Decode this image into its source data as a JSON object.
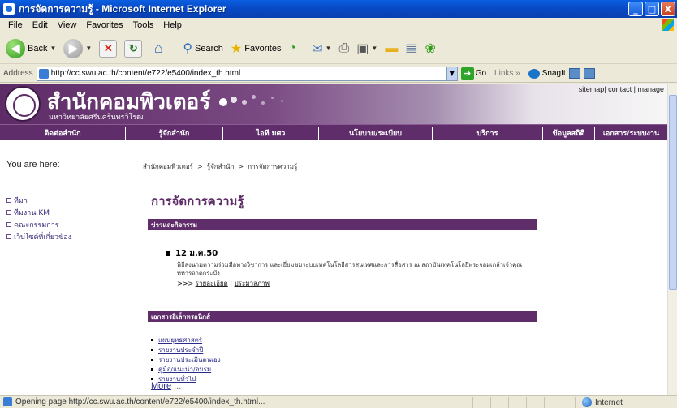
{
  "window": {
    "title": "การจัดการความรู้ - Microsoft Internet Explorer",
    "controls": [
      "_",
      "□",
      "X"
    ]
  },
  "menu": [
    "File",
    "Edit",
    "View",
    "Favorites",
    "Tools",
    "Help"
  ],
  "toolbar": {
    "back_label": "Back",
    "search_label": "Search",
    "favorites_label": "Favorites"
  },
  "addressbar": {
    "label": "Address",
    "url": "http://cc.swu.ac.th/content/e722/e5400/index_th.html",
    "go_label": "Go",
    "links_label": "Links",
    "snagit_label": "SnagIt"
  },
  "site": {
    "org_name": "สำนักคอมพิวเตอร์",
    "org_sub": "มหาวิทยาลัยศรีนครินทรวิโรฒ",
    "util_links": "sitemap| contact | manage"
  },
  "nav": [
    "ติดต่อสำนัก",
    "รู้จักสำนัก",
    "ไอที มศว",
    "นโยบาย/ระเบียบ",
    "บริการ",
    "ข้อมูลสถิติ",
    "เอกสาร/ระบบงาน"
  ],
  "breadcrumb": {
    "you_are_here": "You are here:",
    "items": [
      "สำนักคอมพิวเตอร์",
      "รู้จักสำนัก",
      "การจัดการความรู้"
    ],
    "separator": ">"
  },
  "sidebar": [
    "ทีมา",
    "ทีมงาน KM",
    "คณะกรรมการ",
    "เว็บไซต์ที่เกี่ยวข้อง"
  ],
  "main": {
    "title": "การจัดการความรู้",
    "news_header": "ข่าวและกิจกรรม",
    "news": {
      "date": "12 ม.ค.50",
      "desc": "พิธีลงนามความร่วมมือทางวิชาการ และเยี่ยมชมระบบเทคโนโลยีสารสนเทศและการสื่อสาร ณ สถาบันเทคโนโลยีพระจอมเกล้าเจ้าคุณทหารลาดกระบัง",
      "prefix": ">>>",
      "detail_link": "รายละเอียด",
      "sep": "|",
      "photo_link": "ประมวลภาพ"
    },
    "docs_header": "เอกสารอิเล็กทรอนิกส์",
    "docs": [
      "แผนยุทธศาสตร์",
      "รายงานประจำปี",
      "รายงานประเมินตนเอง",
      "คู่มือ/แนะนำ/อบรม",
      "รายงานทั่วไป"
    ],
    "more": "More",
    "more_ellipsis": "..."
  },
  "status": {
    "text": "Opening page http://cc.swu.ac.th/content/e722/e5400/index_th.html...",
    "zone": "Internet"
  }
}
